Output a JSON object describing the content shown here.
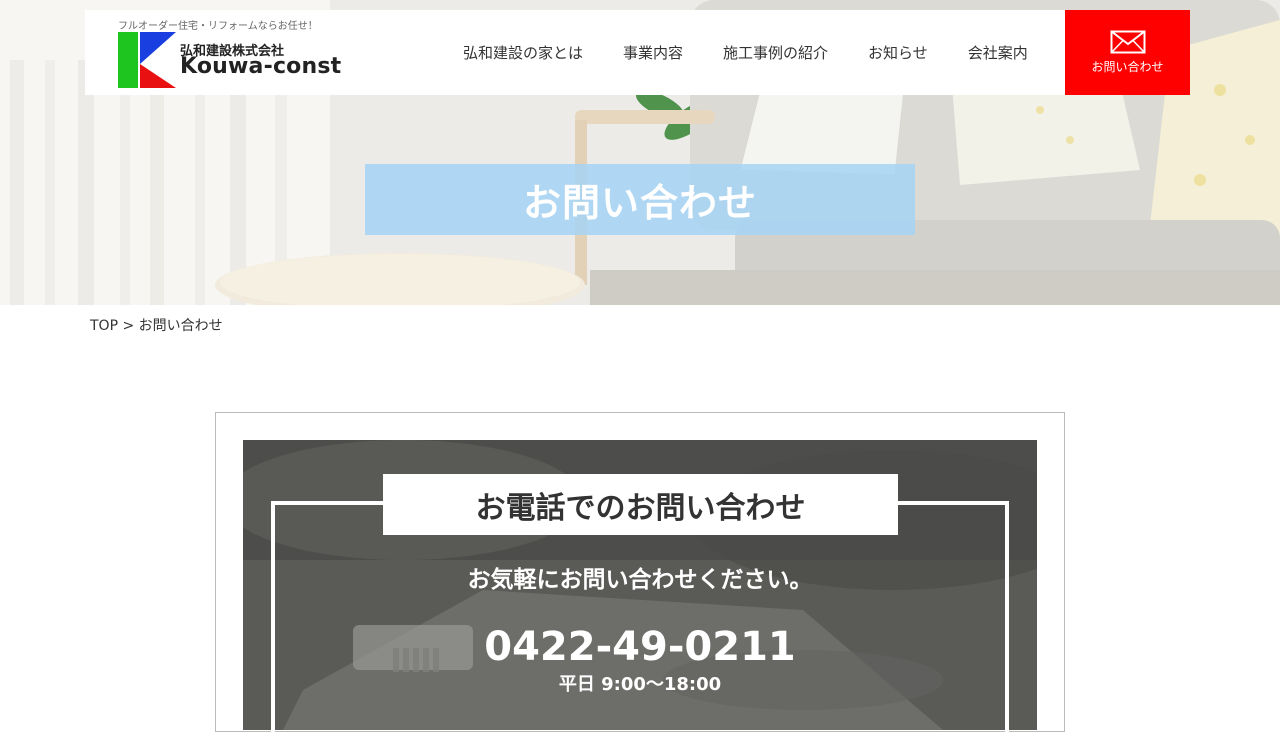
{
  "header": {
    "tagline": "フルオーダー住宅・リフォームならお任せ！",
    "company_jp": "弘和建設株式会社",
    "company_en": "Kouwa-const",
    "nav": [
      {
        "label": "弘和建設の家とは"
      },
      {
        "label": "事業内容"
      },
      {
        "label": "施工事例の紹介"
      },
      {
        "label": "お知らせ"
      },
      {
        "label": "会社案内"
      }
    ],
    "contact_label": "お問い合わせ",
    "contact_icon": "envelope-icon",
    "contact_color": "#ff0000"
  },
  "hero": {
    "title": "お問い合わせ",
    "title_bg": "#a5d4f5"
  },
  "breadcrumb": {
    "top": "TOP",
    "separator": ">",
    "current": "お問い合わせ"
  },
  "phone_section": {
    "heading": "お電話でのお問い合わせ",
    "subtitle": "お気軽にお問い合わせください。",
    "number": "0422-49-0211",
    "hours": "平日 9:00～18:00"
  },
  "logo": {
    "colors": {
      "green": "#1ec51e",
      "blue": "#1a3fe0",
      "red": "#e81010"
    }
  }
}
